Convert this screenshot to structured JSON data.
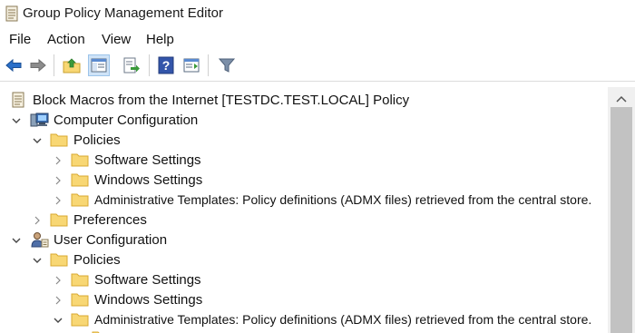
{
  "window": {
    "title": "Group Policy Management Editor",
    "app_icon": "gpo-editor-icon"
  },
  "menu": {
    "items": [
      {
        "label": "File"
      },
      {
        "label": "Action"
      },
      {
        "label": "View"
      },
      {
        "label": "Help"
      }
    ]
  },
  "toolbar": {
    "buttons": [
      {
        "icon": "back-arrow-icon"
      },
      {
        "icon": "forward-arrow-icon"
      },
      {
        "icon": "up-folder-icon"
      },
      {
        "icon": "show-hide-tree-icon"
      },
      {
        "icon": "export-list-icon"
      },
      {
        "icon": "help-icon"
      },
      {
        "icon": "action-pane-icon"
      },
      {
        "icon": "filter-icon"
      }
    ]
  },
  "tree": {
    "root": {
      "label": "Block Macros from the Internet [TESTDC.TEST.LOCAL] Policy",
      "icon": "policy-scroll-icon"
    },
    "computer_config": {
      "label": "Computer Configuration",
      "icon": "computer-icon",
      "expanded": true,
      "policies": {
        "label": "Policies",
        "expanded": true,
        "children": [
          {
            "label": "Software Settings"
          },
          {
            "label": "Windows Settings"
          },
          {
            "label": "Administrative Templates: Policy definitions (ADMX files) retrieved from the central store."
          }
        ]
      },
      "preferences": {
        "label": "Preferences",
        "expanded": false
      }
    },
    "user_config": {
      "label": "User Configuration",
      "icon": "user-icon",
      "expanded": true,
      "policies": {
        "label": "Policies",
        "expanded": true,
        "children": [
          {
            "label": "Software Settings"
          },
          {
            "label": "Windows Settings"
          },
          {
            "label": "Administrative Templates: Policy definitions (ADMX files) retrieved from the central store.",
            "expanded": true
          }
        ]
      }
    }
  },
  "colors": {
    "folder_fill": "#f8d774",
    "folder_edge": "#d9a931",
    "accent_blue": "#2a6fc9",
    "scroll_thumb": "#c2c2c2"
  }
}
